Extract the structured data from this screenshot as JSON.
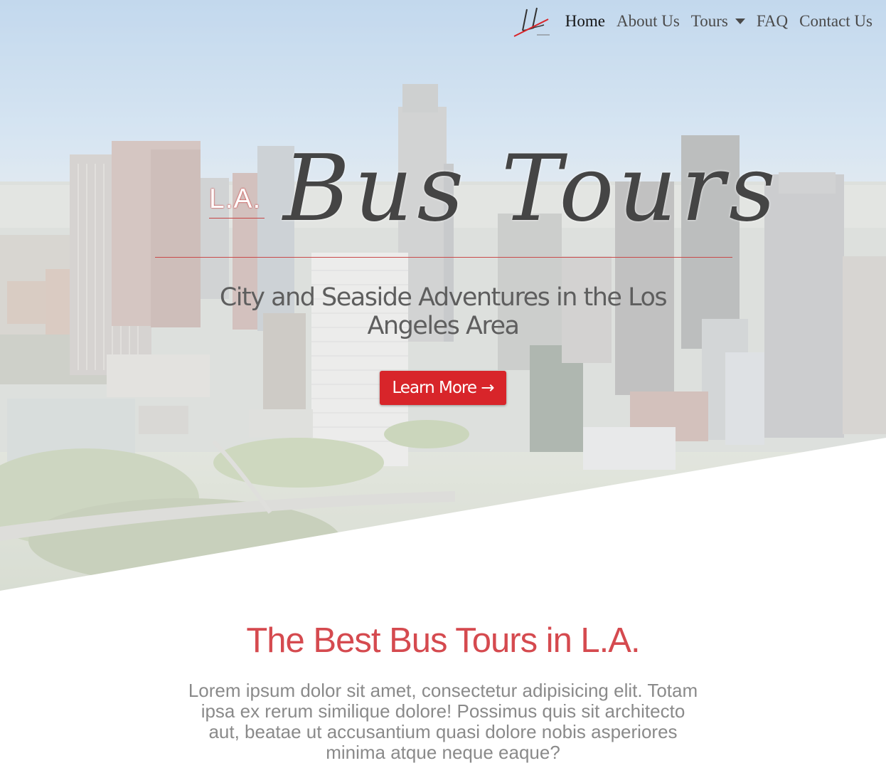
{
  "nav": {
    "logo_icon": "la-bus-tours-logo",
    "items": [
      {
        "label": "Home",
        "active": true
      },
      {
        "label": "About Us",
        "active": false
      },
      {
        "label": "Tours",
        "active": false,
        "dropdown": true
      },
      {
        "label": "FAQ",
        "active": false
      },
      {
        "label": "Contact Us",
        "active": false
      }
    ]
  },
  "hero": {
    "brand_prefix": "L.A.",
    "brand_name": "Bus Tours",
    "tagline": "City and Seaside Adventures in the Los Angeles Area",
    "cta_label": "Learn More →",
    "accent_color": "#d8252a"
  },
  "intro": {
    "title": "The Best Bus Tours in L.A.",
    "body": "Lorem ipsum dolor sit amet, consectetur adipisicing elit. Totam ipsa ex rerum similique dolore! Possimus quis sit architecto aut, beatae ut accusantium quasi dolore nobis asperiores minima atque neque eaque?",
    "title_color": "#d54a4f"
  }
}
